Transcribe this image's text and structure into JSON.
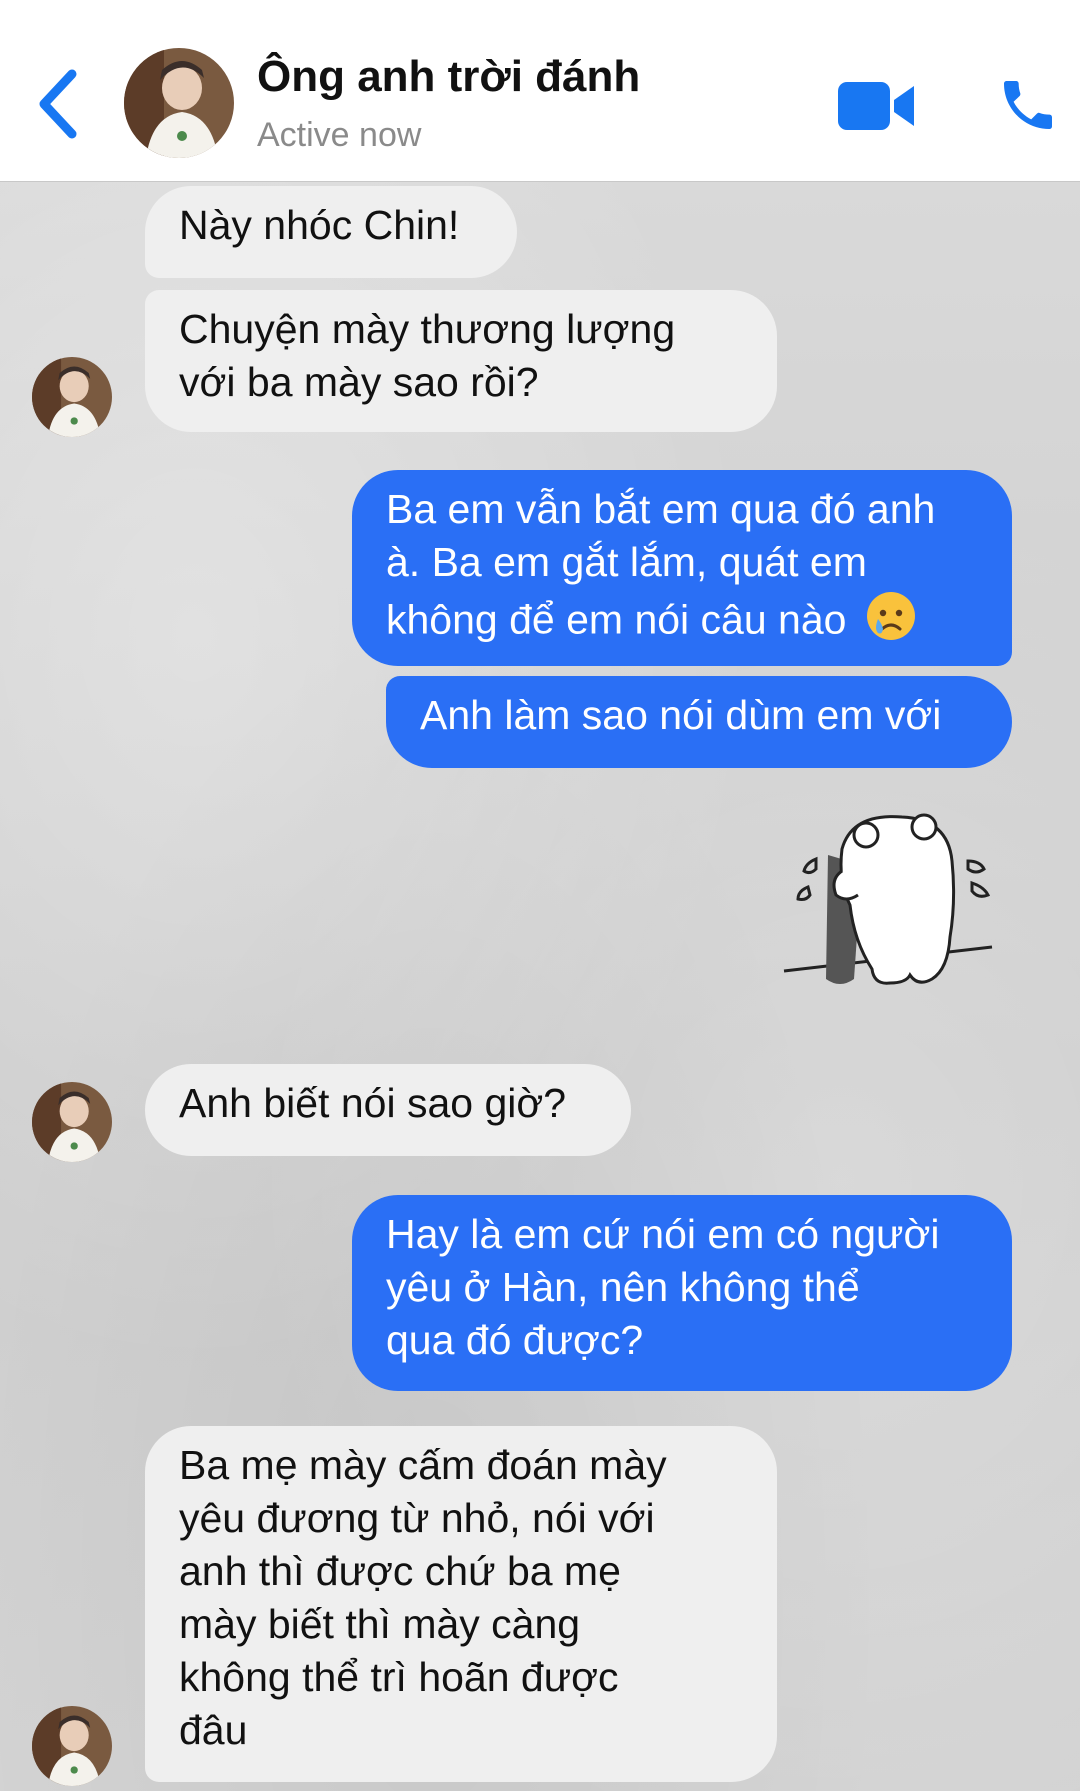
{
  "header": {
    "contact_name": "Ông anh trời đánh",
    "status": "Active now"
  },
  "messages": {
    "m1": "Này nhóc Chin!",
    "m2_l1": "Chuyện mày thương lượng",
    "m2_l2": "với ba mày sao rồi?",
    "m3_l1": "Ba em vẫn bắt em qua đó anh",
    "m3_l2": "à. Ba em gắt lắm, quát em",
    "m3_l3": "không để em nói câu nào",
    "m4": "Anh làm sao nói dùm em với",
    "m5": "Anh biết nói sao giờ?",
    "m6_l1": "Hay là em cứ nói em có người",
    "m6_l2": "yêu ở Hàn, nên không thể",
    "m6_l3": "qua đó được?",
    "m7_l1": "Ba mẹ mày cấm đoán mày",
    "m7_l2": "yêu đương từ nhỏ, nói với",
    "m7_l3": "anh thì được chứ ba mẹ",
    "m7_l4": "mày biết thì mày càng",
    "m7_l5": "không thể trì hoãn được",
    "m7_l6": "đâu"
  },
  "colors": {
    "accent": "#2a6ff5",
    "incoming_bubble": "#efefef",
    "header_icons": "#1877f2"
  },
  "icons": {
    "back": "chevron-left-icon",
    "video": "video-camera-icon",
    "call": "phone-icon",
    "emoji": "sad-tear-emoji-icon",
    "sticker": "crying-bear-sticker"
  }
}
